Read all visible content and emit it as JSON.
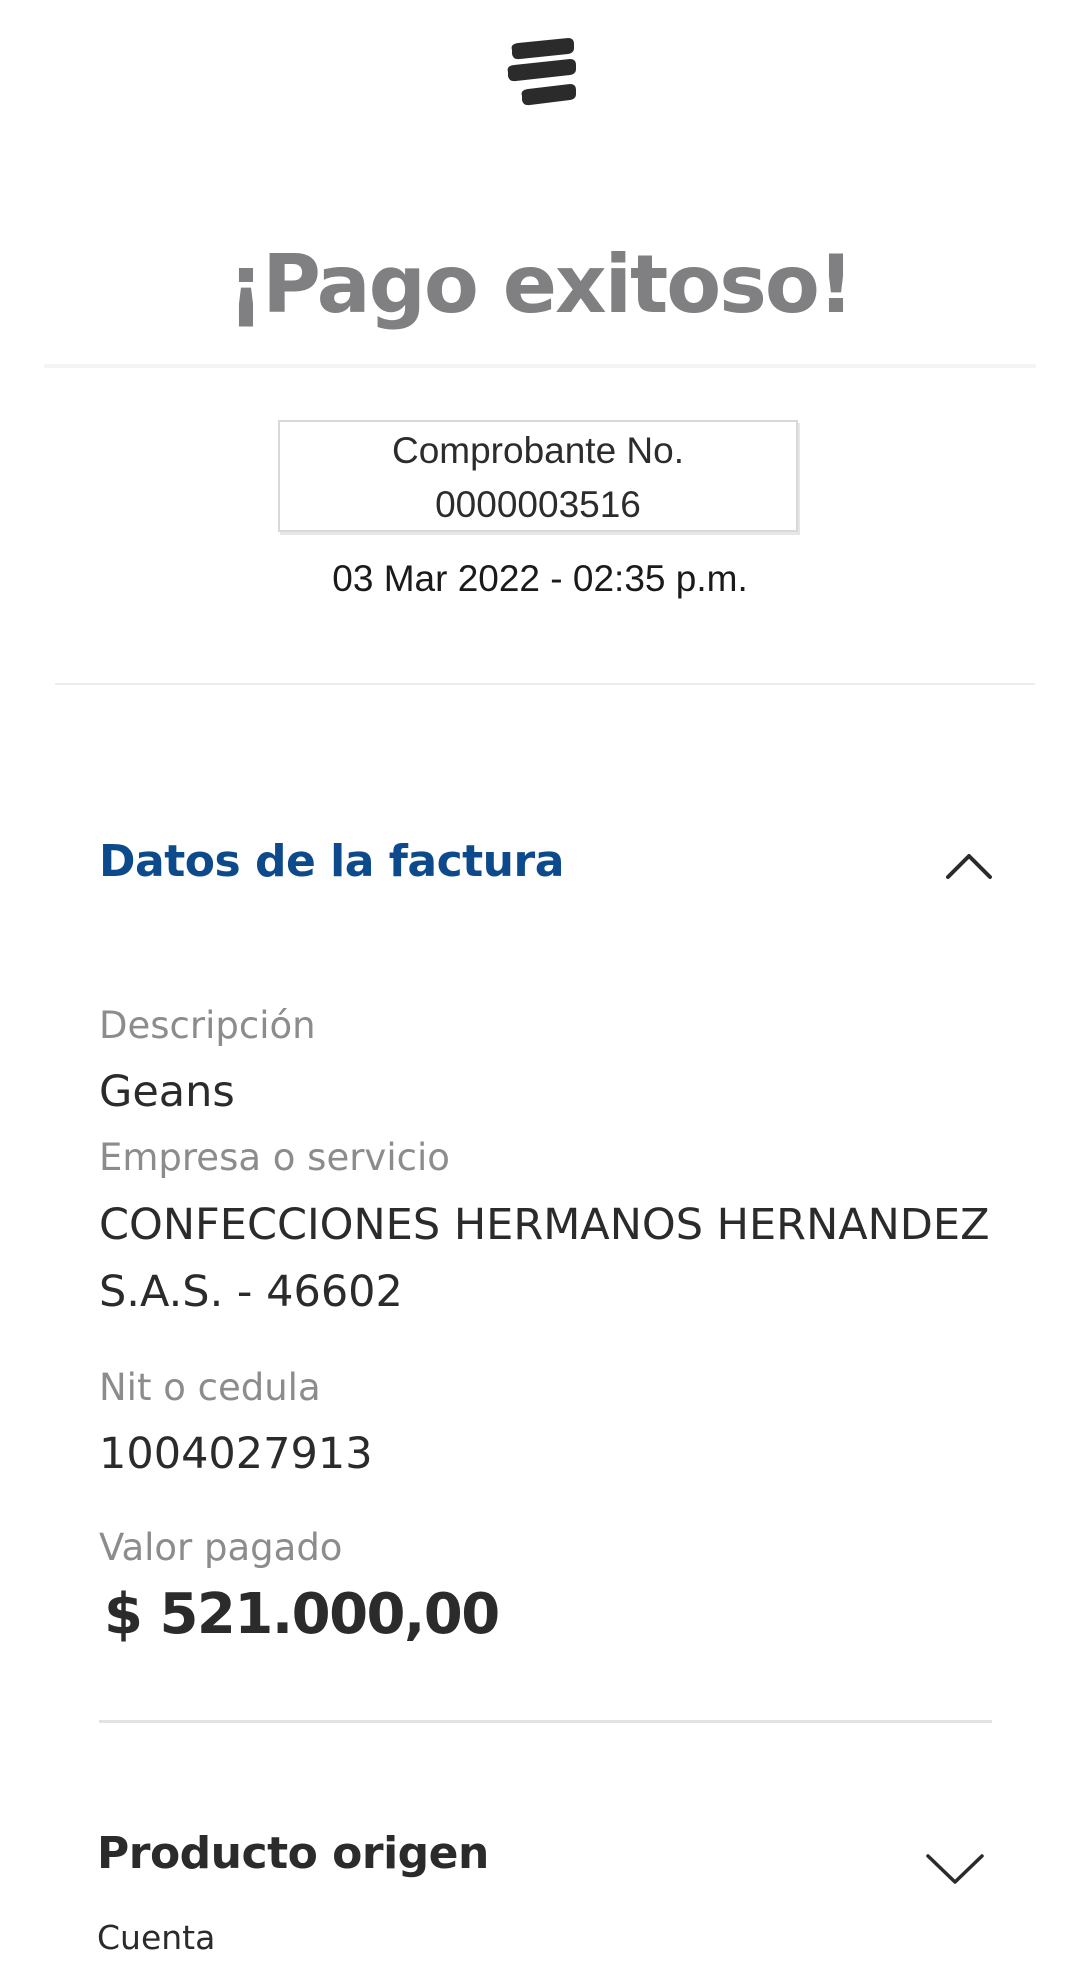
{
  "header": {
    "logo_icon": "bank-logo-icon",
    "title": "¡Pago exitoso!"
  },
  "receipt": {
    "label": "Comprobante No.",
    "number": "0000003516",
    "datetime": "03 Mar 2022 - 02:35 p.m."
  },
  "invoice_section": {
    "title": "Datos de la factura",
    "toggle_icon": "chevron-up-icon",
    "accent_color": "#0d4a8c",
    "fields": {
      "description_label": "Descripción",
      "description_value": "Geans",
      "company_label": "Empresa o servicio",
      "company_value_line1": "CONFECCIONES HERMANOS HERNANDEZ",
      "company_value_line2": "S.A.S. - 46602",
      "id_label": "Nit o cedula",
      "id_value": "1004027913",
      "amount_label": "Valor pagado",
      "amount_value": "$ 521.000,00"
    }
  },
  "product_section": {
    "title": "Producto origen",
    "toggle_icon": "chevron-down-icon",
    "account_label": "Cuenta"
  }
}
